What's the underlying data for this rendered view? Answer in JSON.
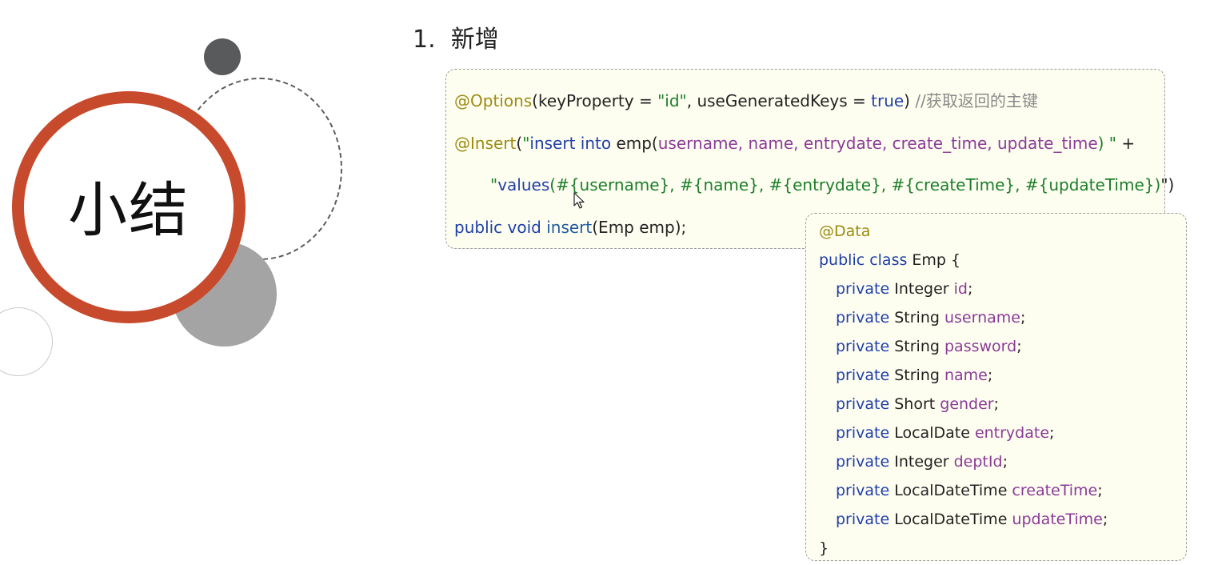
{
  "slide": {
    "title": "小结",
    "heading": "1.  新增"
  },
  "code_block_1": {
    "line1": {
      "annotation": "@Options",
      "args": "(keyProperty = ",
      "id_str": "\"id\"",
      "mid": ", useGeneratedKeys = ",
      "true_kw": "true",
      "close": ")",
      "comment": " //获取返回的主键"
    },
    "line2": {
      "annotation": "@Insert",
      "open": "(",
      "q": "\"",
      "sql_kw": "insert into",
      "table": " emp(",
      "cols": "username, name, entrydate, create_time, update_time",
      "close": ") \"",
      "plus": " +"
    },
    "line3": {
      "q": "\"",
      "values_kw": "values",
      "params": "(#{username}, #{name}, #{entrydate}, #{createTime}, #{updateTime})",
      "close": "\")"
    },
    "line4": {
      "mods": "public void",
      "method": " insert",
      "rest": "(Emp emp);"
    }
  },
  "code_block_2": {
    "annotation": "@Data",
    "class_decl": {
      "mods": "public class",
      "rest": " Emp {"
    },
    "fields": [
      {
        "mod": "private",
        "type": " Integer ",
        "name": "id",
        "end": ";"
      },
      {
        "mod": "private",
        "type": " String ",
        "name": "username",
        "end": ";"
      },
      {
        "mod": "private",
        "type": " String ",
        "name": "password",
        "end": ";"
      },
      {
        "mod": "private",
        "type": " String ",
        "name": "name",
        "end": ";"
      },
      {
        "mod": "private",
        "type": " Short ",
        "name": "gender",
        "end": ";"
      },
      {
        "mod": "private",
        "type": " LocalDate ",
        "name": "entrydate",
        "end": ";"
      },
      {
        "mod": "private",
        "type": " Integer ",
        "name": "deptId",
        "end": ";"
      },
      {
        "mod": "private",
        "type": " LocalDateTime ",
        "name": "createTime",
        "end": ";"
      },
      {
        "mod": "private",
        "type": " LocalDateTime ",
        "name": "updateTime",
        "end": ";"
      }
    ],
    "closing": "}"
  },
  "colors": {
    "accent_ring": "#c84a2c",
    "annotation": "#9c8a12",
    "keyword": "#1f3fa8",
    "string": "#1b7e2b",
    "field": "#8b3a97",
    "comment": "#8a8a8a",
    "code_background": "#fefef0"
  },
  "icons": [
    "mouse-pointer-icon"
  ]
}
